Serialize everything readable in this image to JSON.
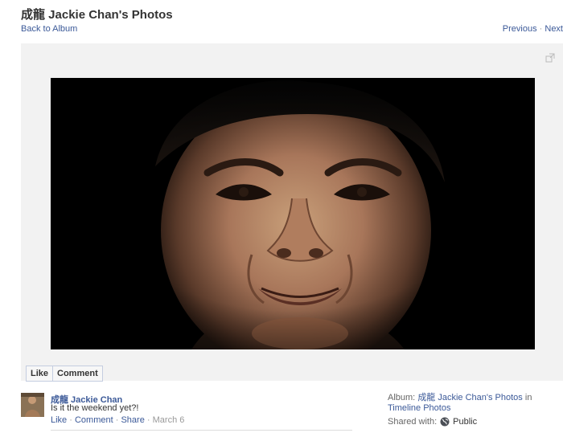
{
  "header": {
    "title": "成龍 Jackie Chan's Photos",
    "back_label": "Back to Album",
    "previous_label": "Previous",
    "separator": "·",
    "next_label": "Next"
  },
  "photo": {
    "description_icon": "expand-icon"
  },
  "actions": {
    "like_label": "Like",
    "comment_label": "Comment"
  },
  "post": {
    "poster_name": "成龍 Jackie Chan",
    "caption": "Is it the weekend yet?!",
    "like_label": "Like",
    "comment_label": "Comment",
    "share_label": "Share",
    "date": "March 6",
    "separator": "·"
  },
  "album_info": {
    "album_prefix": "Album:",
    "album_owner": "成龍 Jackie Chan's Photos",
    "in_word": "in",
    "album_name": "Timeline Photos",
    "shared_with_label": "Shared with:",
    "privacy": "Public",
    "privacy_icon": "globe-icon"
  },
  "colors": {
    "link": "#3b5998",
    "stage_bg": "#f2f2f2"
  }
}
